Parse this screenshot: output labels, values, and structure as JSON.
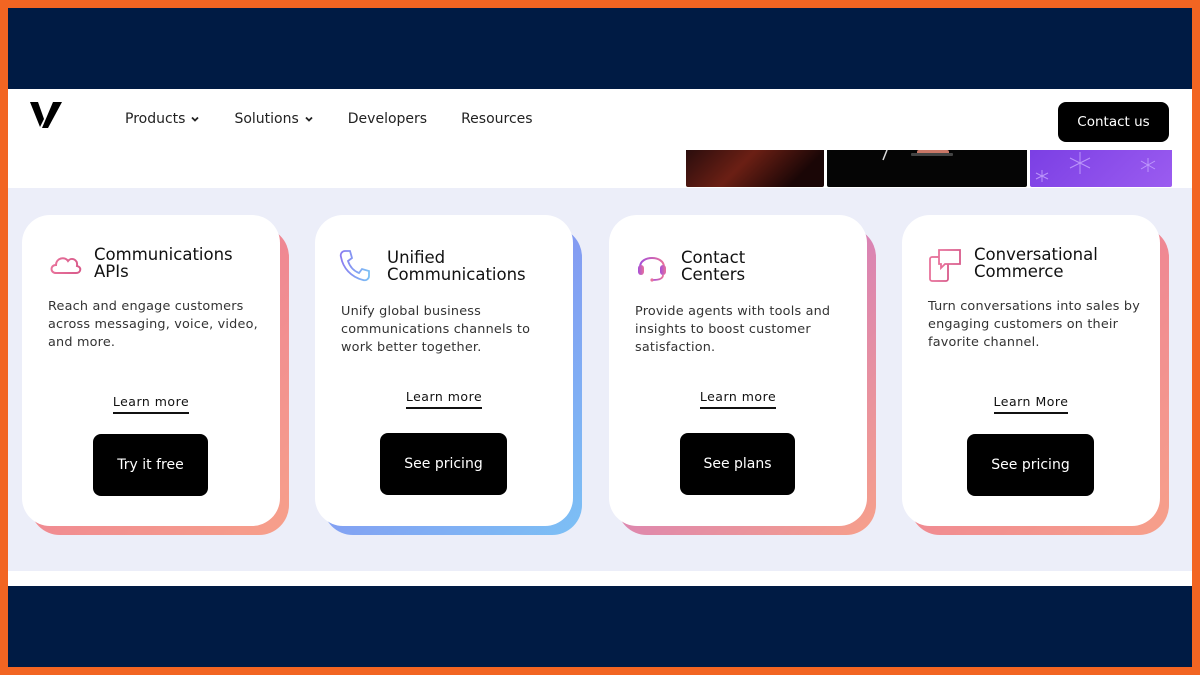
{
  "nav": {
    "items": [
      {
        "label": "Products",
        "has_dropdown": true
      },
      {
        "label": "Solutions",
        "has_dropdown": true
      },
      {
        "label": "Developers",
        "has_dropdown": false
      },
      {
        "label": "Resources",
        "has_dropdown": false
      }
    ],
    "contact_label": "Contact us"
  },
  "cards": [
    {
      "icon": "cloud-icon",
      "title_line1": "Communications",
      "title_line2": "APIs",
      "description": "Reach and engage customers across messaging, voice, video, and more.",
      "learn_label": "Learn more",
      "cta_label": "Try it free",
      "accent": [
        "#e8729b",
        "#f7a08a"
      ]
    },
    {
      "icon": "phone-icon",
      "title_line1": "Unified",
      "title_line2": "Communications",
      "description": "Unify global business communications channels to work better together.",
      "learn_label": "Learn more",
      "cta_label": "See pricing",
      "accent": [
        "#8b7cf0",
        "#7cc0f5"
      ]
    },
    {
      "icon": "headset-icon",
      "title_line1": "Contact",
      "title_line2": "Centers",
      "description": "Provide agents with tools and insights to boost customer satisfaction.",
      "learn_label": "Learn more",
      "cta_label": "See plans",
      "accent": [
        "#c06ad8",
        "#f7a08a"
      ]
    },
    {
      "icon": "chat-commerce-icon",
      "title_line1": "Conversational",
      "title_line2": "Commerce",
      "description": "Turn conversations into sales by engaging customers on their favorite channel.",
      "learn_label": "Learn More",
      "cta_label": "See pricing",
      "accent": [
        "#e8729b",
        "#f7a08a"
      ]
    }
  ],
  "colors": {
    "outer_border": "#f26522",
    "navy": "#001b44",
    "band": "#eceef9",
    "button": "#000000"
  }
}
